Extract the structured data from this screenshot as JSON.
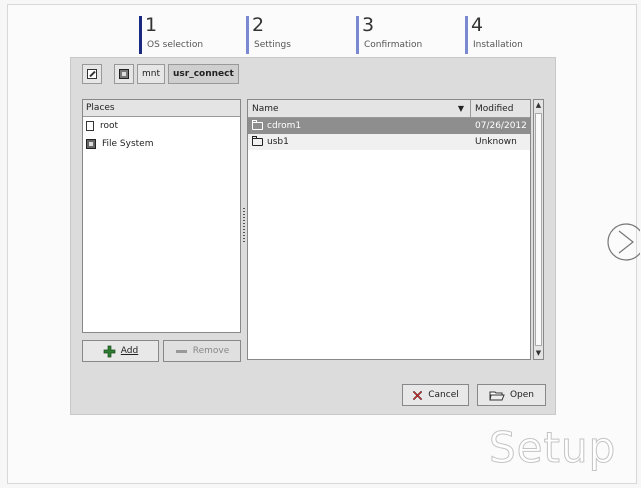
{
  "steps": [
    {
      "number": "1",
      "label": "OS selection",
      "color": "#1a2a80"
    },
    {
      "number": "2",
      "label": "Settings",
      "color": "#7a8ad0"
    },
    {
      "number": "3",
      "label": "Confirmation",
      "color": "#7a8ad0"
    },
    {
      "number": "4",
      "label": "Installation",
      "color": "#7a8ad0"
    }
  ],
  "path_bar": {
    "segments": [
      "mnt",
      "usr_connect"
    ],
    "active": "usr_connect"
  },
  "places": {
    "header": "Places",
    "items": [
      {
        "label": "root",
        "icon": "file-icon"
      },
      {
        "label": "File System",
        "icon": "drive-icon"
      }
    ],
    "add_label": "Add",
    "remove_label": "Remove"
  },
  "files": {
    "columns": {
      "name": "Name",
      "modified": "Modified"
    },
    "rows": [
      {
        "name": "cdrom1",
        "modified": "07/26/2012",
        "selected": true
      },
      {
        "name": "usb1",
        "modified": "Unknown",
        "selected": false
      }
    ]
  },
  "buttons": {
    "cancel": "Cancel",
    "open": "Open"
  },
  "brand": "Setup",
  "colors": {
    "selection": "#8e8e8e",
    "step_active": "#1a2a80",
    "step_inactive": "#7a8ad0"
  }
}
